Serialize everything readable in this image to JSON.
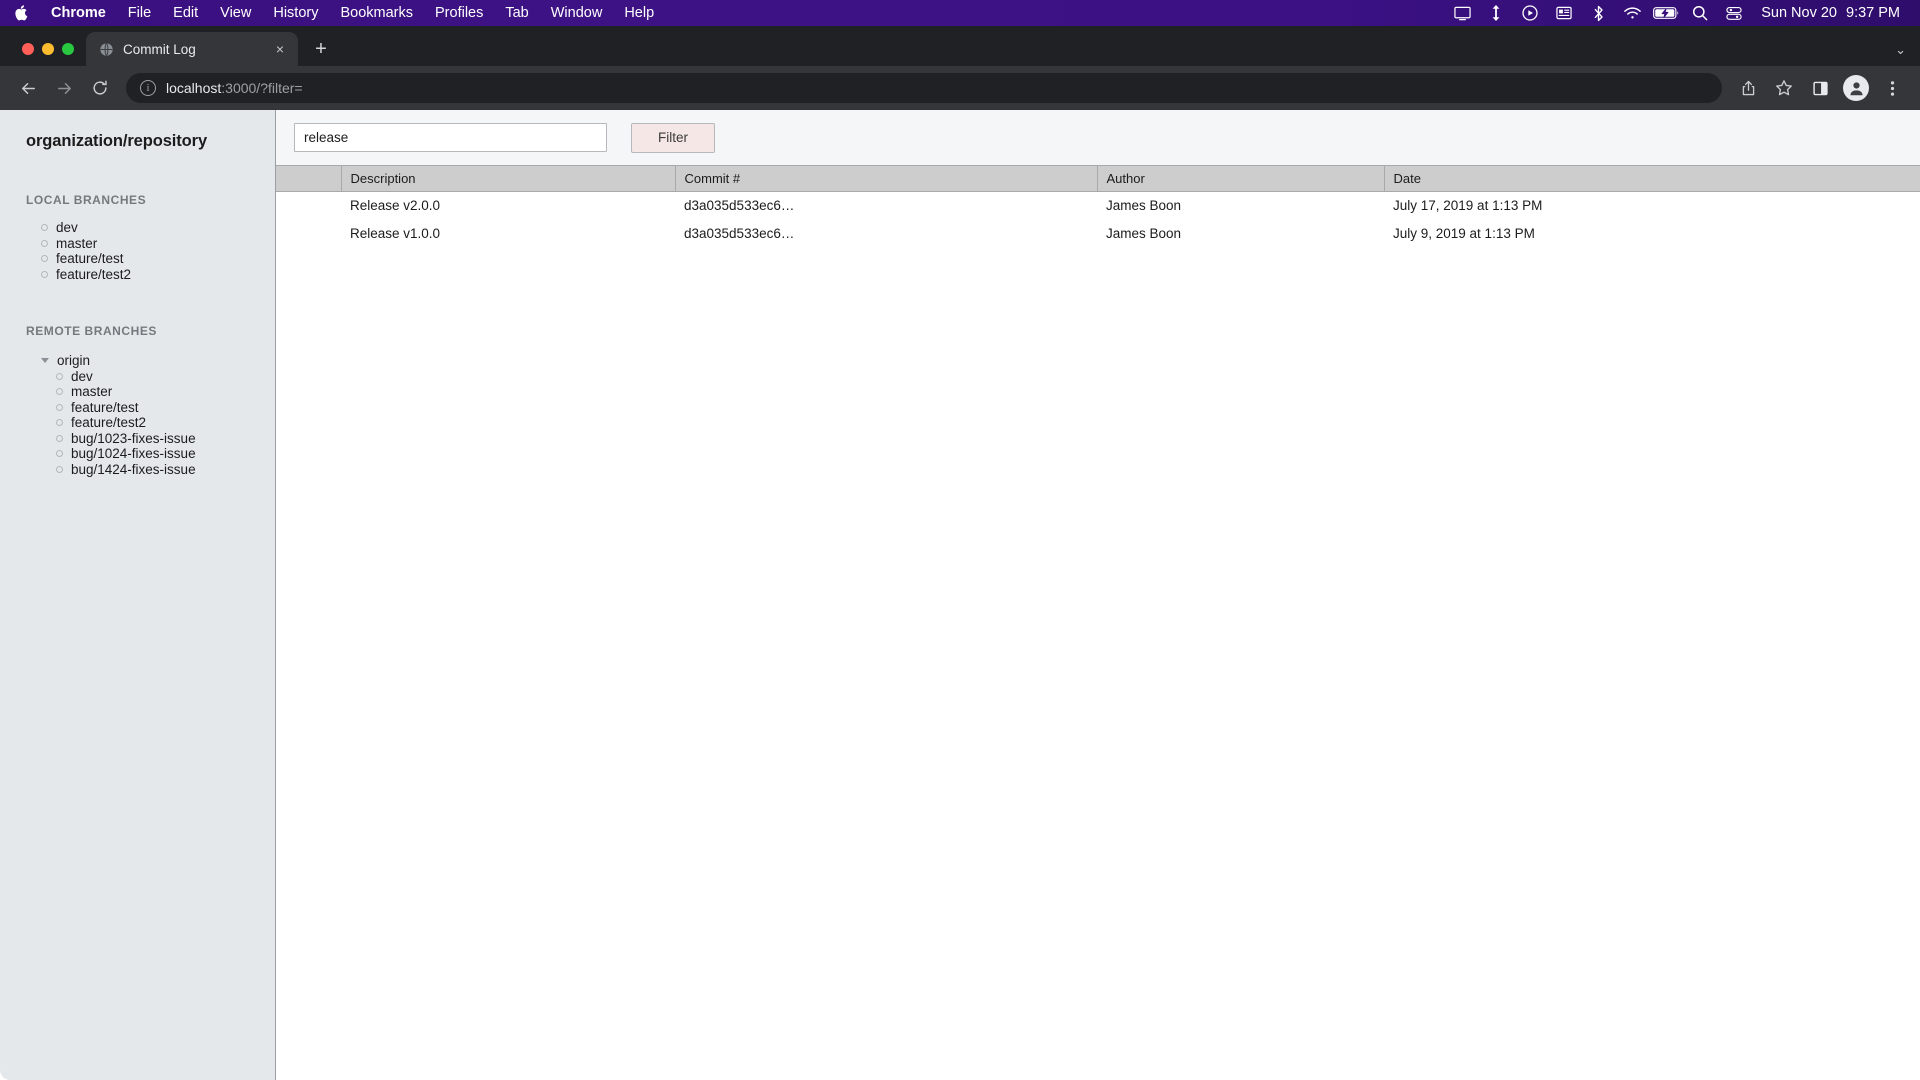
{
  "menubar": {
    "apple_icon": "apple-logo",
    "items": [
      {
        "label": "Chrome",
        "bold": true
      },
      {
        "label": "File",
        "bold": false
      },
      {
        "label": "Edit",
        "bold": false
      },
      {
        "label": "View",
        "bold": false
      },
      {
        "label": "History",
        "bold": false
      },
      {
        "label": "Bookmarks",
        "bold": false
      },
      {
        "label": "Profiles",
        "bold": false
      },
      {
        "label": "Tab",
        "bold": false
      },
      {
        "label": "Window",
        "bold": false
      },
      {
        "label": "Help",
        "bold": false
      }
    ],
    "status_icons": [
      "screen-mirroring-icon",
      "airdrop-arrows-icon",
      "now-playing-icon",
      "news-widget-icon",
      "bluetooth-icon",
      "wifi-icon",
      "battery-charging-icon",
      "spotlight-search-icon",
      "control-center-icon"
    ],
    "date": "Sun Nov 20",
    "time": "9:37 PM"
  },
  "browser": {
    "tab": {
      "title": "Commit Log",
      "favicon": "globe-icon",
      "close_label": "×"
    },
    "new_tab_label": "+",
    "tabstrip_menu_label": "⌄",
    "toolbar": {
      "back_label": "←",
      "forward_label": "→",
      "reload_label": "⟳",
      "info_label": "i",
      "url_host": "localhost",
      "url_rest": ":3000/?filter=",
      "share_icon": "share-icon",
      "bookmark_icon": "star-icon",
      "side_panel_icon": "side-panel-icon",
      "profile_icon": "profile-avatar-icon",
      "menu_icon": "three-dot-menu-icon"
    }
  },
  "sidebar": {
    "repo_title": "organization/repository",
    "local_header": "LOCAL BRANCHES",
    "local_branches": [
      {
        "label": "dev"
      },
      {
        "label": "master"
      },
      {
        "label": "feature/test"
      },
      {
        "label": "feature/test2"
      }
    ],
    "remote_header": "REMOTE BRANCHES",
    "remote_root": {
      "label": "origin"
    },
    "remote_branches": [
      {
        "label": "dev"
      },
      {
        "label": "master"
      },
      {
        "label": "feature/test"
      },
      {
        "label": "feature/test2"
      },
      {
        "label": "bug/1023-fixes-issue"
      },
      {
        "label": "bug/1024-fixes-issue"
      },
      {
        "label": "bug/1424-fixes-issue"
      }
    ]
  },
  "main": {
    "filter": {
      "value": "release",
      "placeholder": "",
      "button_label": "Filter",
      "button_color": "#f4e7e5"
    },
    "table": {
      "columns": [
        "",
        "Description",
        "Commit #",
        "Author",
        "Date"
      ],
      "rows": [
        {
          "spacer": "",
          "description": "Release v2.0.0",
          "commit": "d3a035d533ec6…",
          "author": "James Boon",
          "date": "July 17, 2019 at 1:13 PM"
        },
        {
          "spacer": "",
          "description": "Release v1.0.0",
          "commit": "d3a035d533ec6…",
          "author": "James Boon",
          "date": "July 9, 2019 at 1:13 PM"
        }
      ]
    }
  }
}
